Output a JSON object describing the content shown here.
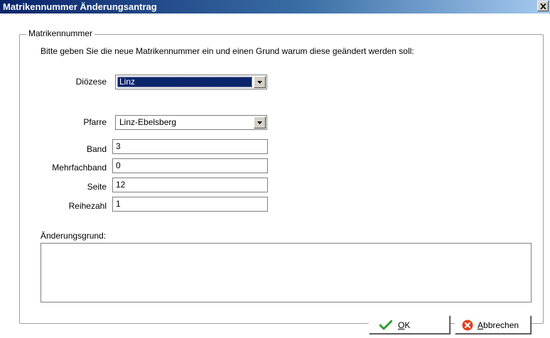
{
  "window": {
    "title": "Matrikennummer Änderungsantrag",
    "close_icon": "close-icon"
  },
  "group": {
    "legend": "Matrikennummer",
    "instruction": "Bitte geben Sie die neue Matrikennummer ein und einen Grund warum diese geändert werden soll:"
  },
  "form": {
    "dioezese": {
      "label": "Diözese",
      "value": "Linz"
    },
    "pfarre": {
      "label": "Pfarre",
      "value": "Linz-Ebelsberg"
    },
    "band": {
      "label": "Band",
      "value": "3"
    },
    "mehrfachband": {
      "label": "Mehrfachband",
      "value": "0"
    },
    "seite": {
      "label": "Seite",
      "value": "12"
    },
    "reihezahl": {
      "label": "Reihezahl",
      "value": "1"
    },
    "grund": {
      "label": "Änderungsgrund:",
      "value": ""
    }
  },
  "buttons": {
    "ok": {
      "mnemonic": "O",
      "rest": "K",
      "icon": "checkmark-icon",
      "color": "#2e9e2e"
    },
    "cancel": {
      "mnemonic": "A",
      "rest": "bbrechen",
      "icon": "cancel-icon",
      "color": "#e04020"
    }
  }
}
